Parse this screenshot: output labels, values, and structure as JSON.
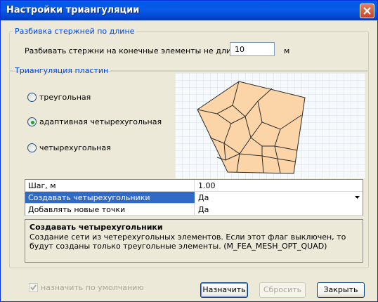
{
  "window": {
    "title": "Настройки триангуляции"
  },
  "length_group": {
    "legend": "Разбивка стержней по длине",
    "label": "Разбивать стержни на конечные элементы не длиннее:",
    "value": "10",
    "unit": "м"
  },
  "plate_group": {
    "legend": "Триангуляция пластин",
    "options": [
      {
        "label": "треугольная",
        "selected": false
      },
      {
        "label": "адаптивная четырехугольная",
        "selected": true
      },
      {
        "label": "четырехугольная",
        "selected": false
      }
    ]
  },
  "properties": [
    {
      "name": "Шаг, м",
      "value": "1.00"
    },
    {
      "name": "Создавать четырехугольники",
      "value": "Да"
    },
    {
      "name": "Добавлять новые точки",
      "value": "Да"
    }
  ],
  "description": {
    "title": "Создавать четырехугольники",
    "text": "Создание сети из четерехугольных элементов. Если этот флаг выключен, то будут созданы только треугольные элементы. (M_FEA_MESH_OPT_QUAD)"
  },
  "footer": {
    "default_checkbox": "назначить по умолчанию",
    "default_checked": true,
    "assign_button": "Назначить",
    "reset_button": "Сбросить",
    "close_button": "Закрыть"
  },
  "colors": {
    "mesh_fill": "#fbd4a8",
    "mesh_stroke": "#2b2b2b",
    "selection": "#316ac5",
    "accent": "#0046d5"
  }
}
